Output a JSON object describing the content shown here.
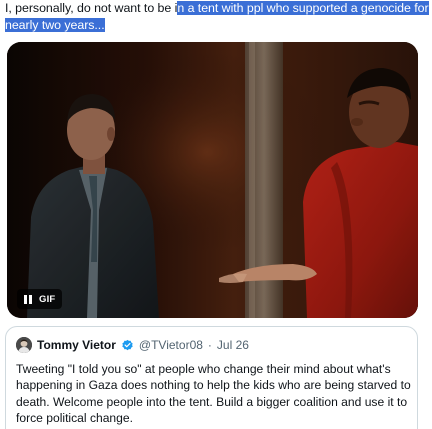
{
  "tweet": {
    "text_plain": "I, personally, do not want to be i",
    "text_selected": "n a tent with ppl who supported a genocide for nearly two years..."
  },
  "media": {
    "badge_label": "GIF",
    "pause_icon": "pause-icon"
  },
  "quote": {
    "author_name": "Tommy Vietor",
    "verified_icon": "verified-badge-icon",
    "handle": "@TVietor08",
    "separator": "·",
    "date": "Jul 26",
    "text": "Tweeting \"I told you so\" at people who change their mind about what's happening in Gaza does nothing to help the kids who are being starved to death. Welcome people into the tent. Build a bigger coalition and use it to force political change."
  },
  "colors": {
    "selection": "#3b6fd6",
    "verified": "#1d9bf0",
    "secondary_text": "#536471",
    "border": "#cfd9de"
  }
}
